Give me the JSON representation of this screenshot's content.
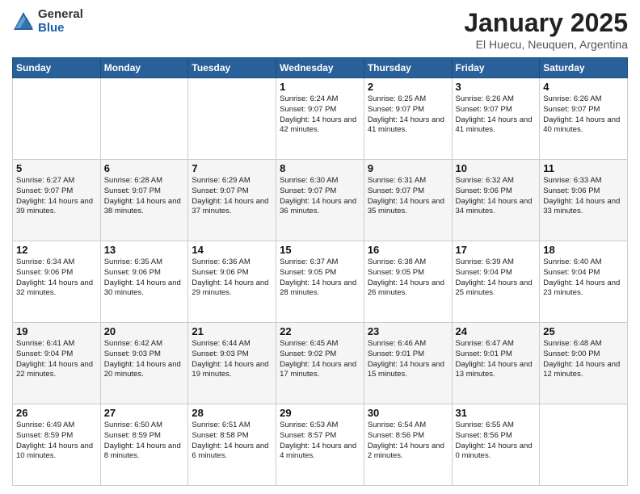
{
  "logo": {
    "general": "General",
    "blue": "Blue"
  },
  "title": {
    "month": "January 2025",
    "location": "El Huecu, Neuquen, Argentina"
  },
  "weekdays": [
    "Sunday",
    "Monday",
    "Tuesday",
    "Wednesday",
    "Thursday",
    "Friday",
    "Saturday"
  ],
  "weeks": [
    [
      {
        "day": "",
        "sunrise": "",
        "sunset": "",
        "daylight": ""
      },
      {
        "day": "",
        "sunrise": "",
        "sunset": "",
        "daylight": ""
      },
      {
        "day": "",
        "sunrise": "",
        "sunset": "",
        "daylight": ""
      },
      {
        "day": "1",
        "sunrise": "Sunrise: 6:24 AM",
        "sunset": "Sunset: 9:07 PM",
        "daylight": "Daylight: 14 hours and 42 minutes."
      },
      {
        "day": "2",
        "sunrise": "Sunrise: 6:25 AM",
        "sunset": "Sunset: 9:07 PM",
        "daylight": "Daylight: 14 hours and 41 minutes."
      },
      {
        "day": "3",
        "sunrise": "Sunrise: 6:26 AM",
        "sunset": "Sunset: 9:07 PM",
        "daylight": "Daylight: 14 hours and 41 minutes."
      },
      {
        "day": "4",
        "sunrise": "Sunrise: 6:26 AM",
        "sunset": "Sunset: 9:07 PM",
        "daylight": "Daylight: 14 hours and 40 minutes."
      }
    ],
    [
      {
        "day": "5",
        "sunrise": "Sunrise: 6:27 AM",
        "sunset": "Sunset: 9:07 PM",
        "daylight": "Daylight: 14 hours and 39 minutes."
      },
      {
        "day": "6",
        "sunrise": "Sunrise: 6:28 AM",
        "sunset": "Sunset: 9:07 PM",
        "daylight": "Daylight: 14 hours and 38 minutes."
      },
      {
        "day": "7",
        "sunrise": "Sunrise: 6:29 AM",
        "sunset": "Sunset: 9:07 PM",
        "daylight": "Daylight: 14 hours and 37 minutes."
      },
      {
        "day": "8",
        "sunrise": "Sunrise: 6:30 AM",
        "sunset": "Sunset: 9:07 PM",
        "daylight": "Daylight: 14 hours and 36 minutes."
      },
      {
        "day": "9",
        "sunrise": "Sunrise: 6:31 AM",
        "sunset": "Sunset: 9:07 PM",
        "daylight": "Daylight: 14 hours and 35 minutes."
      },
      {
        "day": "10",
        "sunrise": "Sunrise: 6:32 AM",
        "sunset": "Sunset: 9:06 PM",
        "daylight": "Daylight: 14 hours and 34 minutes."
      },
      {
        "day": "11",
        "sunrise": "Sunrise: 6:33 AM",
        "sunset": "Sunset: 9:06 PM",
        "daylight": "Daylight: 14 hours and 33 minutes."
      }
    ],
    [
      {
        "day": "12",
        "sunrise": "Sunrise: 6:34 AM",
        "sunset": "Sunset: 9:06 PM",
        "daylight": "Daylight: 14 hours and 32 minutes."
      },
      {
        "day": "13",
        "sunrise": "Sunrise: 6:35 AM",
        "sunset": "Sunset: 9:06 PM",
        "daylight": "Daylight: 14 hours and 30 minutes."
      },
      {
        "day": "14",
        "sunrise": "Sunrise: 6:36 AM",
        "sunset": "Sunset: 9:06 PM",
        "daylight": "Daylight: 14 hours and 29 minutes."
      },
      {
        "day": "15",
        "sunrise": "Sunrise: 6:37 AM",
        "sunset": "Sunset: 9:05 PM",
        "daylight": "Daylight: 14 hours and 28 minutes."
      },
      {
        "day": "16",
        "sunrise": "Sunrise: 6:38 AM",
        "sunset": "Sunset: 9:05 PM",
        "daylight": "Daylight: 14 hours and 26 minutes."
      },
      {
        "day": "17",
        "sunrise": "Sunrise: 6:39 AM",
        "sunset": "Sunset: 9:04 PM",
        "daylight": "Daylight: 14 hours and 25 minutes."
      },
      {
        "day": "18",
        "sunrise": "Sunrise: 6:40 AM",
        "sunset": "Sunset: 9:04 PM",
        "daylight": "Daylight: 14 hours and 23 minutes."
      }
    ],
    [
      {
        "day": "19",
        "sunrise": "Sunrise: 6:41 AM",
        "sunset": "Sunset: 9:04 PM",
        "daylight": "Daylight: 14 hours and 22 minutes."
      },
      {
        "day": "20",
        "sunrise": "Sunrise: 6:42 AM",
        "sunset": "Sunset: 9:03 PM",
        "daylight": "Daylight: 14 hours and 20 minutes."
      },
      {
        "day": "21",
        "sunrise": "Sunrise: 6:44 AM",
        "sunset": "Sunset: 9:03 PM",
        "daylight": "Daylight: 14 hours and 19 minutes."
      },
      {
        "day": "22",
        "sunrise": "Sunrise: 6:45 AM",
        "sunset": "Sunset: 9:02 PM",
        "daylight": "Daylight: 14 hours and 17 minutes."
      },
      {
        "day": "23",
        "sunrise": "Sunrise: 6:46 AM",
        "sunset": "Sunset: 9:01 PM",
        "daylight": "Daylight: 14 hours and 15 minutes."
      },
      {
        "day": "24",
        "sunrise": "Sunrise: 6:47 AM",
        "sunset": "Sunset: 9:01 PM",
        "daylight": "Daylight: 14 hours and 13 minutes."
      },
      {
        "day": "25",
        "sunrise": "Sunrise: 6:48 AM",
        "sunset": "Sunset: 9:00 PM",
        "daylight": "Daylight: 14 hours and 12 minutes."
      }
    ],
    [
      {
        "day": "26",
        "sunrise": "Sunrise: 6:49 AM",
        "sunset": "Sunset: 8:59 PM",
        "daylight": "Daylight: 14 hours and 10 minutes."
      },
      {
        "day": "27",
        "sunrise": "Sunrise: 6:50 AM",
        "sunset": "Sunset: 8:59 PM",
        "daylight": "Daylight: 14 hours and 8 minutes."
      },
      {
        "day": "28",
        "sunrise": "Sunrise: 6:51 AM",
        "sunset": "Sunset: 8:58 PM",
        "daylight": "Daylight: 14 hours and 6 minutes."
      },
      {
        "day": "29",
        "sunrise": "Sunrise: 6:53 AM",
        "sunset": "Sunset: 8:57 PM",
        "daylight": "Daylight: 14 hours and 4 minutes."
      },
      {
        "day": "30",
        "sunrise": "Sunrise: 6:54 AM",
        "sunset": "Sunset: 8:56 PM",
        "daylight": "Daylight: 14 hours and 2 minutes."
      },
      {
        "day": "31",
        "sunrise": "Sunrise: 6:55 AM",
        "sunset": "Sunset: 8:56 PM",
        "daylight": "Daylight: 14 hours and 0 minutes."
      },
      {
        "day": "",
        "sunrise": "",
        "sunset": "",
        "daylight": ""
      }
    ]
  ]
}
